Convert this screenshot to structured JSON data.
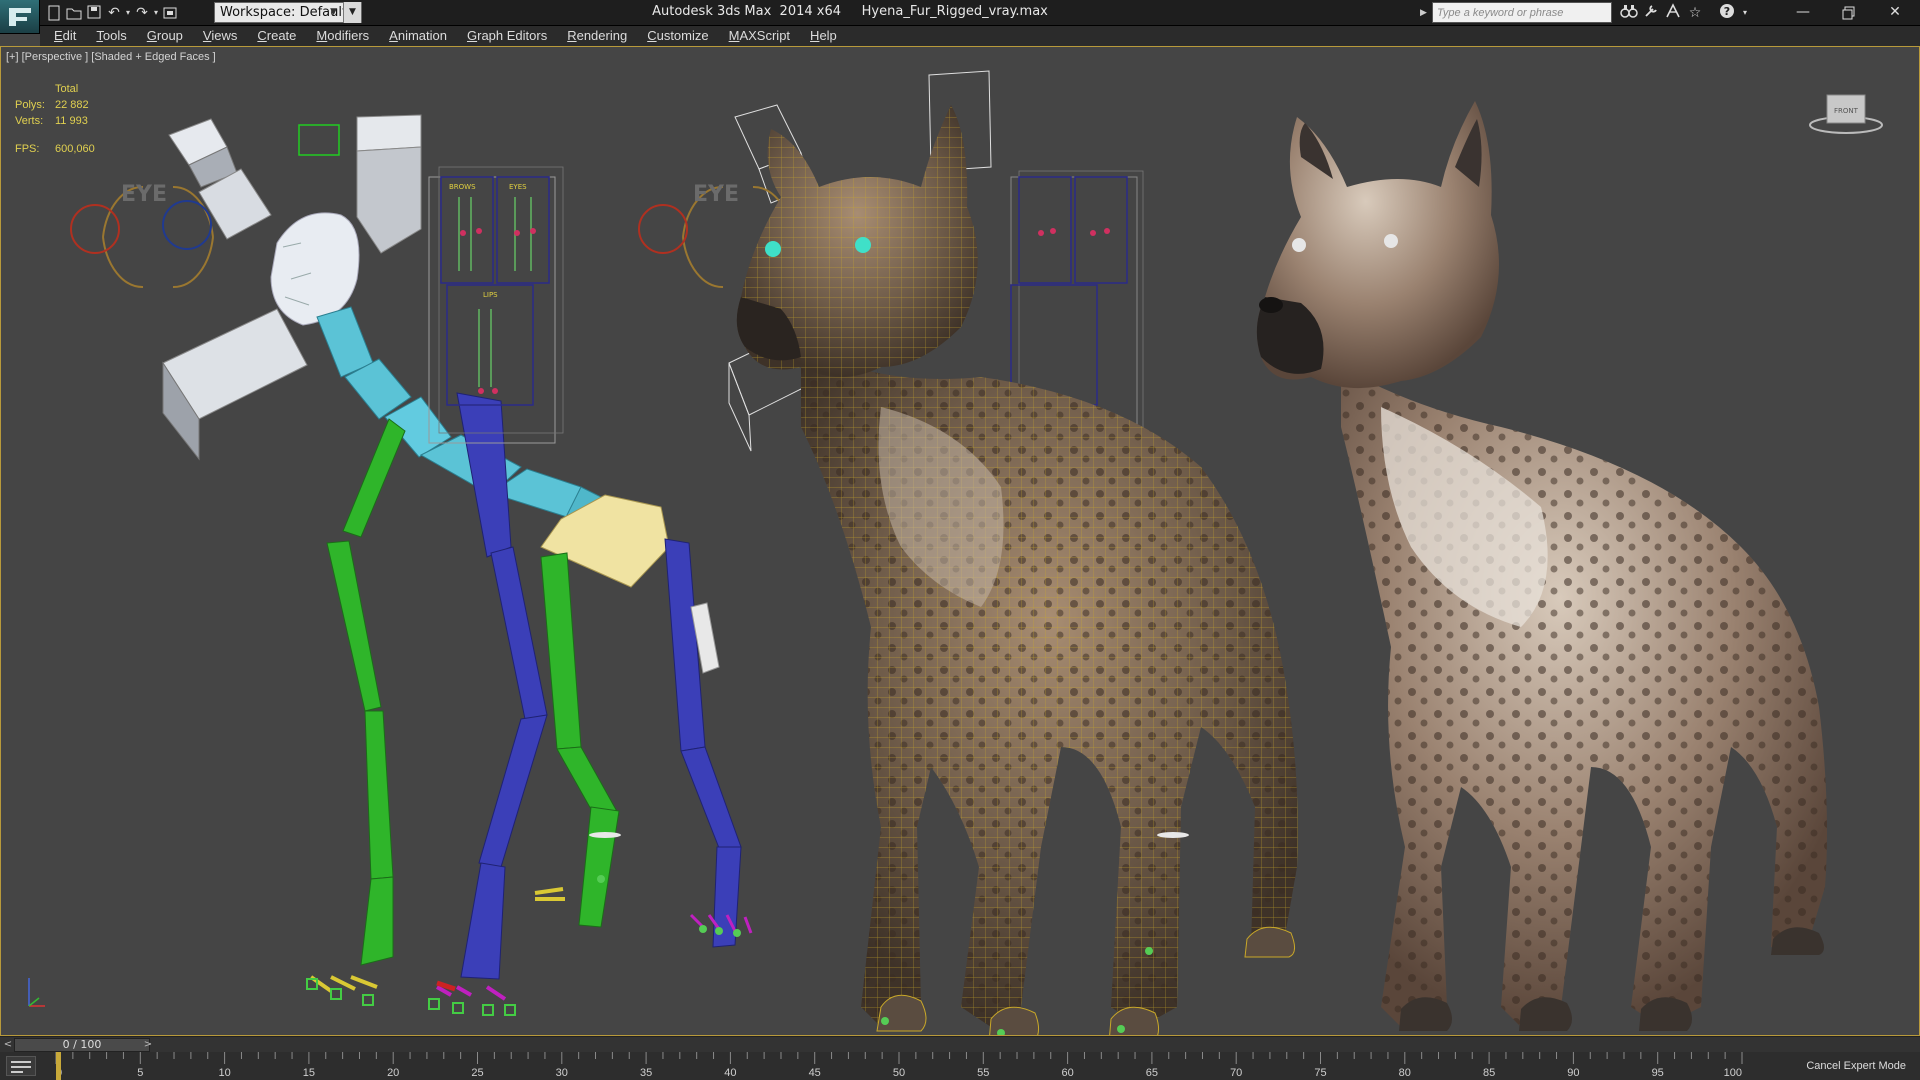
{
  "titlebar": {
    "workspace_label": "Workspace: Default",
    "window_title": "Autodesk 3ds Max  2014 x64     Hyena_Fur_Rigged_vray.max",
    "search_placeholder": "Type a keyword or phrase"
  },
  "menu": {
    "items": [
      "Edit",
      "Tools",
      "Group",
      "Views",
      "Create",
      "Modifiers",
      "Animation",
      "Graph Editors",
      "Rendering",
      "Customize",
      "MAXScript",
      "Help"
    ]
  },
  "viewport": {
    "label": "[+] [Perspective ] [Shaded + Edged Faces ]",
    "stats": {
      "header": "Total",
      "polys_label": "Polys:",
      "polys_value": "22 882",
      "verts_label": "Verts:",
      "verts_value": "11 993",
      "fps_label": "FPS:",
      "fps_value": "600,060"
    },
    "rig_labels": {
      "eye": "EYE",
      "brows": "BROWS",
      "eyes": "EYES",
      "lips": "LIPS"
    },
    "viewcube_text": "FRONT",
    "colors": {
      "bone_cyan": "#5bc3d6",
      "bone_green": "#2fb52a",
      "bone_blue": "#3b3fb8",
      "bone_yellow": "#f0e3a2",
      "wire_gold": "#c9a829",
      "selection_border": "#b89a3b"
    }
  },
  "timeline": {
    "frame_display": "0 / 100",
    "prev_icon": "<",
    "next_icon": ">",
    "ticks": [
      "0",
      "5",
      "10",
      "15",
      "20",
      "25",
      "30",
      "35",
      "40",
      "45",
      "50",
      "55",
      "60",
      "65",
      "70",
      "75",
      "80",
      "85",
      "90",
      "95",
      "100"
    ],
    "current_frame": 0,
    "total_frames": 100
  },
  "status": {
    "cancel_expert_label": "Cancel Expert Mode"
  }
}
